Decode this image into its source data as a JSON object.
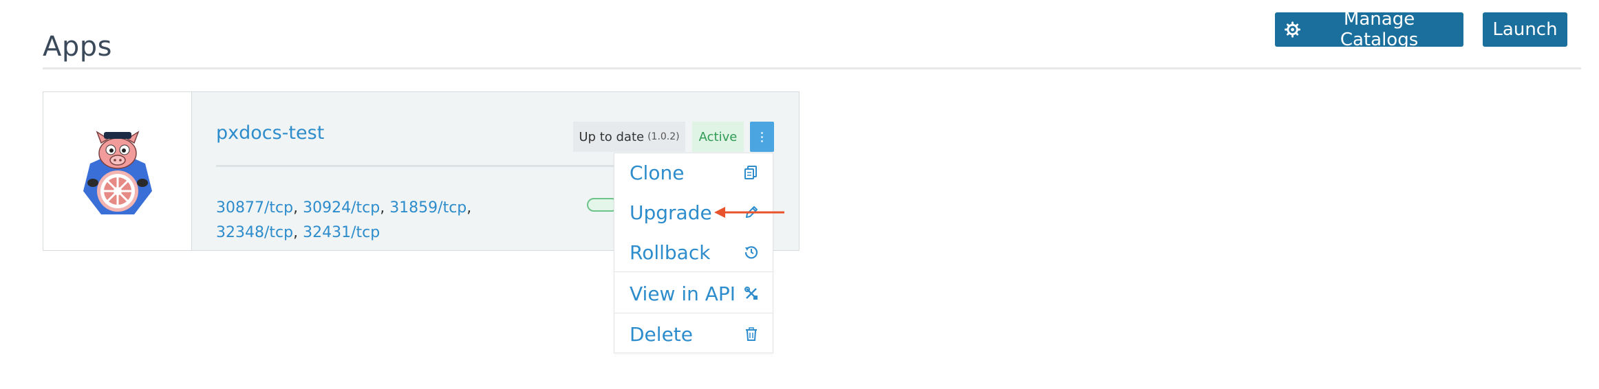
{
  "page": {
    "title": "Apps"
  },
  "header": {
    "manage_catalogs_label": "Manage Catalogs",
    "launch_label": "Launch"
  },
  "app": {
    "name": "pxdocs-test",
    "status_text": "Up to date",
    "version": "(1.0.2)",
    "state": "Active",
    "logo_icon": "kubernetes-helm-pig-logo",
    "ports": [
      "30877/tcp",
      "30924/tcp",
      "31859/tcp",
      "32348/tcp",
      "32431/tcp"
    ]
  },
  "actions_menu": {
    "items": [
      {
        "label": "Clone",
        "icon": "clone-icon"
      },
      {
        "label": "Upgrade",
        "icon": "pencil-icon"
      },
      {
        "label": "Rollback",
        "icon": "history-icon"
      },
      {
        "label": "View in API",
        "icon": "tools-icon"
      },
      {
        "label": "Delete",
        "icon": "trash-icon"
      }
    ]
  },
  "colors": {
    "primary_button": "#1a6f9c",
    "link": "#2d8ccb",
    "active_badge_bg": "#dff4e5",
    "active_badge_text": "#2f9a54",
    "kebab_button": "#4aa5e0",
    "annotation_arrow": "#e8532c"
  }
}
